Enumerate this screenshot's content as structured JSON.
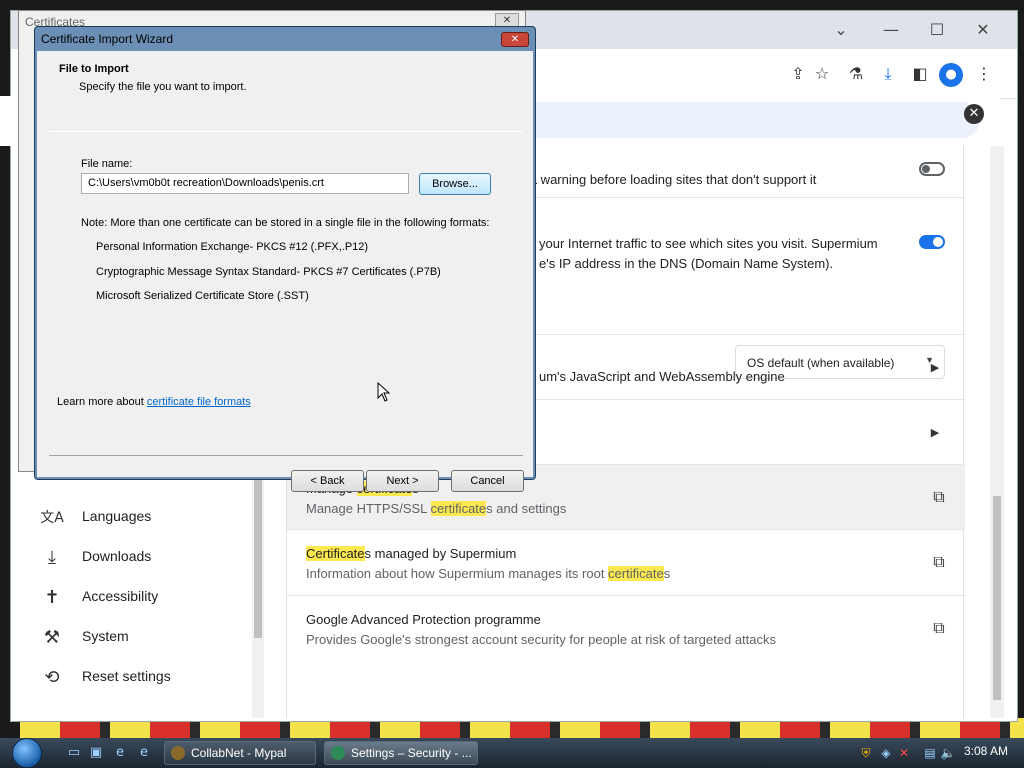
{
  "browser": {
    "min_label": "—",
    "max_label": "☐",
    "close_label": "✕",
    "chevron_label": "⌄",
    "toolbar_icons": [
      "share",
      "star",
      "flask",
      "download",
      "sidepanel",
      "account",
      "menu"
    ]
  },
  "cert_parent": {
    "title": "Certificates",
    "close_label": "✕"
  },
  "wizard": {
    "title": "Certificate Import Wizard",
    "close_label": "✕",
    "header_title": "File to Import",
    "header_subtitle": "Specify the file you want to import.",
    "file_label": "File name:",
    "file_value": "C:\\Users\\vm0b0t recreation\\Downloads\\penis.crt",
    "browse_label": "Browse...",
    "note": "Note:  More than one certificate can be stored in a single file in the following formats:",
    "formats": [
      "Personal Information Exchange- PKCS #12 (.PFX,.P12)",
      "Cryptographic Message Syntax Standard- PKCS #7 Certificates (.P7B)",
      "Microsoft Serialized Certificate Store (.SST)"
    ],
    "learn_prefix": "Learn more about ",
    "learn_link": "certificate file formats",
    "back_label": "< Back",
    "next_label": "Next >",
    "cancel_label": "Cancel"
  },
  "settings": {
    "rows": [
      {
        "text_a": "e a warning before loading sites that don't support it"
      },
      {
        "text_a": "your Internet traffic to see which sites you visit. Supermium",
        "text_b": "e's IP address in the DNS (Domain Name System)."
      },
      {
        "select": "OS default (when available)"
      },
      {
        "text_a": "um's JavaScript and WebAssembly engine"
      }
    ],
    "manage": {
      "l1_a": "Manage ",
      "l1_hl": "certificate",
      "l1_b": "s",
      "l2_a": "Manage HTTPS/SSL ",
      "l2_hl": "certificate",
      "l2_b": "s and settings"
    },
    "managed": {
      "l1_hl": "Certificate",
      "l1_b": "s managed by Supermium",
      "l2_a": "Information about how Supermium manages its root ",
      "l2_hl": "certificate",
      "l2_b": "s"
    },
    "gap": {
      "l1": "Google Advanced Protection programme",
      "l2": "Provides Google's strongest account security for people at risk of targeted attacks"
    }
  },
  "sidebar": {
    "items": [
      {
        "label": "Languages",
        "icon": "文A"
      },
      {
        "label": "Downloads",
        "icon": "⤓"
      },
      {
        "label": "Accessibility",
        "icon": "♿"
      },
      {
        "label": "System",
        "icon": "🔧"
      },
      {
        "label": "Reset settings",
        "icon": "↺"
      }
    ]
  },
  "taskbar": {
    "tasks": [
      {
        "label": "CollabNet - Mypal"
      },
      {
        "label": "Settings – Security - ..."
      }
    ],
    "clock": "3:08 AM"
  }
}
